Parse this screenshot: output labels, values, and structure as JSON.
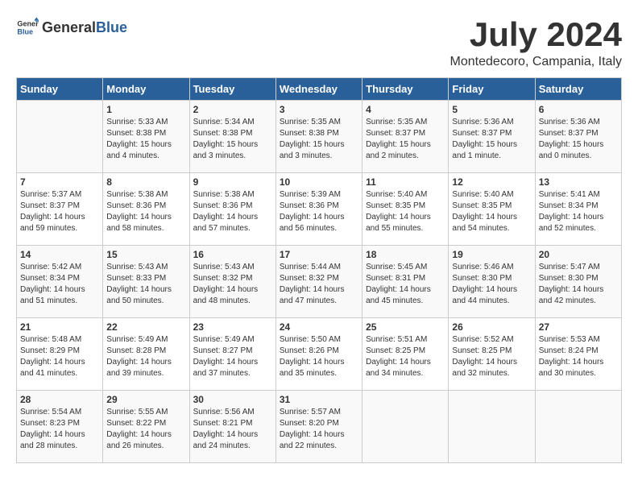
{
  "header": {
    "logo_general": "General",
    "logo_blue": "Blue",
    "month_year": "July 2024",
    "location": "Montedecoro, Campania, Italy"
  },
  "days_of_week": [
    "Sunday",
    "Monday",
    "Tuesday",
    "Wednesday",
    "Thursday",
    "Friday",
    "Saturday"
  ],
  "weeks": [
    [
      {
        "day": "",
        "info": ""
      },
      {
        "day": "1",
        "info": "Sunrise: 5:33 AM\nSunset: 8:38 PM\nDaylight: 15 hours\nand 4 minutes."
      },
      {
        "day": "2",
        "info": "Sunrise: 5:34 AM\nSunset: 8:38 PM\nDaylight: 15 hours\nand 3 minutes."
      },
      {
        "day": "3",
        "info": "Sunrise: 5:35 AM\nSunset: 8:38 PM\nDaylight: 15 hours\nand 3 minutes."
      },
      {
        "day": "4",
        "info": "Sunrise: 5:35 AM\nSunset: 8:37 PM\nDaylight: 15 hours\nand 2 minutes."
      },
      {
        "day": "5",
        "info": "Sunrise: 5:36 AM\nSunset: 8:37 PM\nDaylight: 15 hours\nand 1 minute."
      },
      {
        "day": "6",
        "info": "Sunrise: 5:36 AM\nSunset: 8:37 PM\nDaylight: 15 hours\nand 0 minutes."
      }
    ],
    [
      {
        "day": "7",
        "info": "Sunrise: 5:37 AM\nSunset: 8:37 PM\nDaylight: 14 hours\nand 59 minutes."
      },
      {
        "day": "8",
        "info": "Sunrise: 5:38 AM\nSunset: 8:36 PM\nDaylight: 14 hours\nand 58 minutes."
      },
      {
        "day": "9",
        "info": "Sunrise: 5:38 AM\nSunset: 8:36 PM\nDaylight: 14 hours\nand 57 minutes."
      },
      {
        "day": "10",
        "info": "Sunrise: 5:39 AM\nSunset: 8:36 PM\nDaylight: 14 hours\nand 56 minutes."
      },
      {
        "day": "11",
        "info": "Sunrise: 5:40 AM\nSunset: 8:35 PM\nDaylight: 14 hours\nand 55 minutes."
      },
      {
        "day": "12",
        "info": "Sunrise: 5:40 AM\nSunset: 8:35 PM\nDaylight: 14 hours\nand 54 minutes."
      },
      {
        "day": "13",
        "info": "Sunrise: 5:41 AM\nSunset: 8:34 PM\nDaylight: 14 hours\nand 52 minutes."
      }
    ],
    [
      {
        "day": "14",
        "info": "Sunrise: 5:42 AM\nSunset: 8:34 PM\nDaylight: 14 hours\nand 51 minutes."
      },
      {
        "day": "15",
        "info": "Sunrise: 5:43 AM\nSunset: 8:33 PM\nDaylight: 14 hours\nand 50 minutes."
      },
      {
        "day": "16",
        "info": "Sunrise: 5:43 AM\nSunset: 8:32 PM\nDaylight: 14 hours\nand 48 minutes."
      },
      {
        "day": "17",
        "info": "Sunrise: 5:44 AM\nSunset: 8:32 PM\nDaylight: 14 hours\nand 47 minutes."
      },
      {
        "day": "18",
        "info": "Sunrise: 5:45 AM\nSunset: 8:31 PM\nDaylight: 14 hours\nand 45 minutes."
      },
      {
        "day": "19",
        "info": "Sunrise: 5:46 AM\nSunset: 8:30 PM\nDaylight: 14 hours\nand 44 minutes."
      },
      {
        "day": "20",
        "info": "Sunrise: 5:47 AM\nSunset: 8:30 PM\nDaylight: 14 hours\nand 42 minutes."
      }
    ],
    [
      {
        "day": "21",
        "info": "Sunrise: 5:48 AM\nSunset: 8:29 PM\nDaylight: 14 hours\nand 41 minutes."
      },
      {
        "day": "22",
        "info": "Sunrise: 5:49 AM\nSunset: 8:28 PM\nDaylight: 14 hours\nand 39 minutes."
      },
      {
        "day": "23",
        "info": "Sunrise: 5:49 AM\nSunset: 8:27 PM\nDaylight: 14 hours\nand 37 minutes."
      },
      {
        "day": "24",
        "info": "Sunrise: 5:50 AM\nSunset: 8:26 PM\nDaylight: 14 hours\nand 35 minutes."
      },
      {
        "day": "25",
        "info": "Sunrise: 5:51 AM\nSunset: 8:25 PM\nDaylight: 14 hours\nand 34 minutes."
      },
      {
        "day": "26",
        "info": "Sunrise: 5:52 AM\nSunset: 8:25 PM\nDaylight: 14 hours\nand 32 minutes."
      },
      {
        "day": "27",
        "info": "Sunrise: 5:53 AM\nSunset: 8:24 PM\nDaylight: 14 hours\nand 30 minutes."
      }
    ],
    [
      {
        "day": "28",
        "info": "Sunrise: 5:54 AM\nSunset: 8:23 PM\nDaylight: 14 hours\nand 28 minutes."
      },
      {
        "day": "29",
        "info": "Sunrise: 5:55 AM\nSunset: 8:22 PM\nDaylight: 14 hours\nand 26 minutes."
      },
      {
        "day": "30",
        "info": "Sunrise: 5:56 AM\nSunset: 8:21 PM\nDaylight: 14 hours\nand 24 minutes."
      },
      {
        "day": "31",
        "info": "Sunrise: 5:57 AM\nSunset: 8:20 PM\nDaylight: 14 hours\nand 22 minutes."
      },
      {
        "day": "",
        "info": ""
      },
      {
        "day": "",
        "info": ""
      },
      {
        "day": "",
        "info": ""
      }
    ]
  ]
}
